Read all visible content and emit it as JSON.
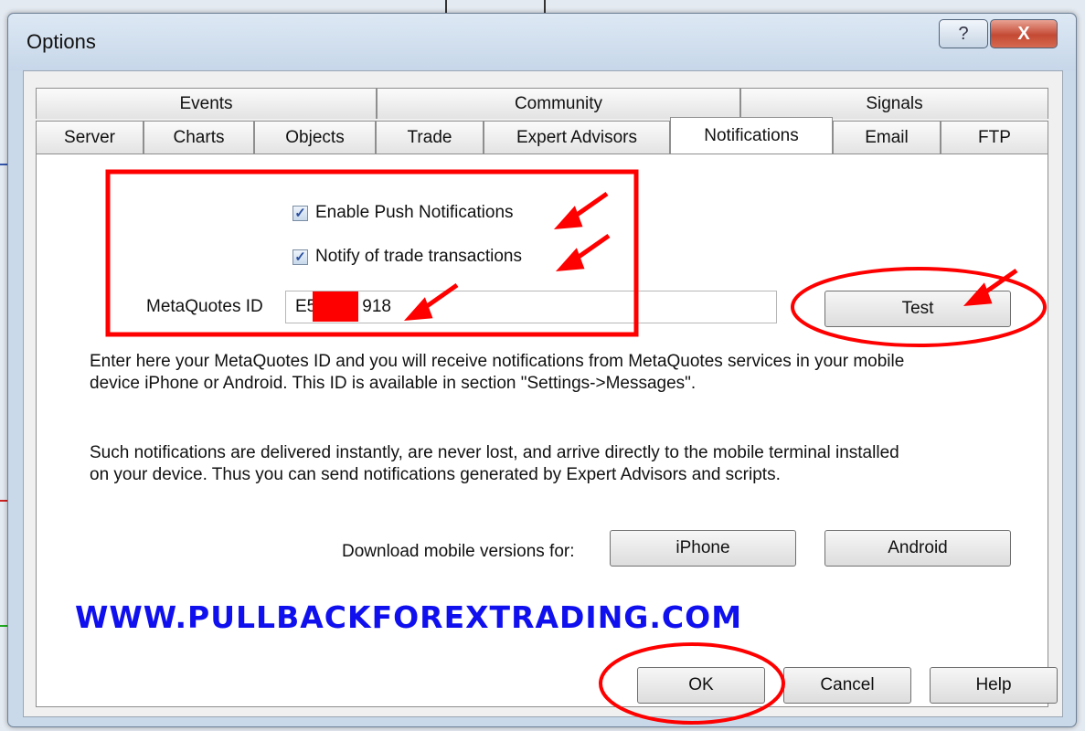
{
  "window": {
    "title": "Options",
    "help_glyph": "?",
    "close_glyph": "X"
  },
  "tabs": {
    "row1": [
      "Events",
      "Community",
      "Signals"
    ],
    "row2": [
      "Server",
      "Charts",
      "Objects",
      "Trade",
      "Expert Advisors",
      "Notifications",
      "Email",
      "FTP"
    ],
    "active": "Notifications"
  },
  "notifications": {
    "enable_push_label": "Enable Push Notifications",
    "enable_push_checked": true,
    "notify_trade_label": "Notify of trade transactions",
    "notify_trade_checked": true,
    "metaquotes_label": "MetaQuotes ID",
    "metaquotes_value_prefix": "E5",
    "metaquotes_value_suffix": "918",
    "test_button": "Test",
    "info_paragraph_1_line_1": "Enter here your MetaQuotes ID and you will receive notifications from MetaQuotes services in your mobile",
    "info_paragraph_1_line_2": "device iPhone or Android. This ID is available in section \"Settings->Messages\".",
    "info_paragraph_2_line_1": "Such notifications are delivered instantly, are never lost, and arrive directly to the mobile terminal installed",
    "info_paragraph_2_line_2": "on your device. Thus you can send notifications generated by Expert Advisors and scripts.",
    "download_label": "Download mobile versions for:",
    "iphone_button": "iPhone",
    "android_button": "Android"
  },
  "watermark": "WWW.PULLBACKFOREXTRADING.COM",
  "footer": {
    "ok_button": "OK",
    "cancel_button": "Cancel",
    "help_button": "Help"
  },
  "colors": {
    "annotation_red": "#ff0000",
    "watermark_blue": "#1010ee"
  }
}
